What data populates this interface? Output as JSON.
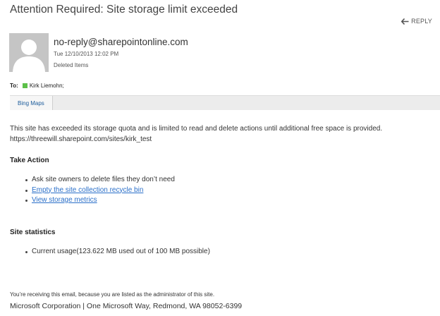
{
  "message": {
    "subject": "Attention Required: Site storage limit exceeded",
    "reply_label": "REPLY",
    "reply_icon": "arrow-left-icon",
    "sender": "no-reply@sharepointonline.com",
    "sent": "Tue 12/10/2013 12:02 PM",
    "folder": "Deleted Items",
    "to_label": "To:",
    "recipient": "Kirk Liemohn;",
    "recipient_presence_color": "#5cc049",
    "apps_tab": "Bing Maps"
  },
  "body": {
    "intro": "This site has exceeded its storage quota and is limited to read and delete actions until additional free space is provided.",
    "site_url": "https://threewill.sharepoint.com/sites/kirk_test",
    "take_action_heading": "Take Action",
    "actions": [
      "Ask site owners to delete files they don’t need",
      "Empty the site collection recycle bin",
      "View storage metrics"
    ],
    "stats_heading": "Site statistics",
    "stats": [
      "Current usage(123.622 MB used out of 100 MB possible)"
    ],
    "footer_note": "You’re receiving this email, because you are listed as the administrator of this site.",
    "footer_address": "Microsoft Corporation | One Microsoft Way, Redmond, WA 98052-6399"
  },
  "colors": {
    "link": "#2a6fc9",
    "tab_text": "#1a5a9a"
  }
}
